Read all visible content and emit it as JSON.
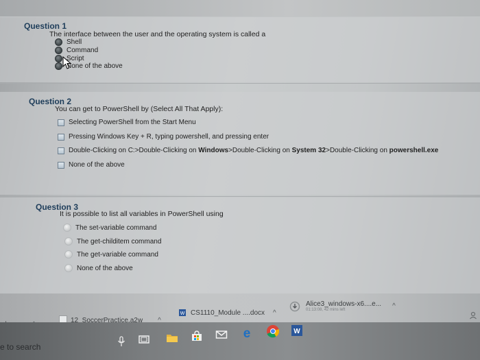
{
  "questions": [
    {
      "title": "Question 1",
      "text": "The interface between the user and the operating system is called a",
      "options": [
        "Shell",
        "Command",
        "Script",
        "None of the above"
      ]
    },
    {
      "title": "Question 2",
      "text": "You can get to PowerShell by (Select All That Apply):",
      "options": [
        "Selecting PowerShell from the Start Menu",
        "Pressing Windows Key + R, typing powershell, and pressing enter",
        {
          "p1": "Double-Clicking on C:>Double-Clicking on ",
          "b1": "Windows",
          "p2": ">Double-Clicking on ",
          "b2": "System 32",
          "p3": ">Double-Clicking on ",
          "b3": "powershell.exe"
        },
        "None of the above"
      ]
    },
    {
      "title": "Question 3",
      "text": "It is possible to list all variables in PowerShell using",
      "options": [
        "The set-variable command",
        "The get-childitem command",
        "The get-variable command",
        "None of the above"
      ]
    }
  ],
  "downloads": {
    "left_partial": "docx",
    "items": [
      {
        "name": "12_SoccerPractice.a2w"
      },
      {
        "name": "CS1110_Module ....docx"
      },
      {
        "name": "Alice3_windows-x6....e...",
        "status": "01:13:08, 42 mins left"
      }
    ]
  },
  "taskbar": {
    "search_partial": "e to search",
    "icons": [
      "microphone-icon",
      "task-view-icon",
      "file-explorer-icon",
      "store-icon",
      "mail-icon",
      "edge-icon",
      "chrome-icon",
      "word-icon"
    ]
  },
  "colors": {
    "question_title": "#1e3d5a",
    "edge_blue": "#1e6fc2",
    "word_blue": "#2b579a"
  }
}
